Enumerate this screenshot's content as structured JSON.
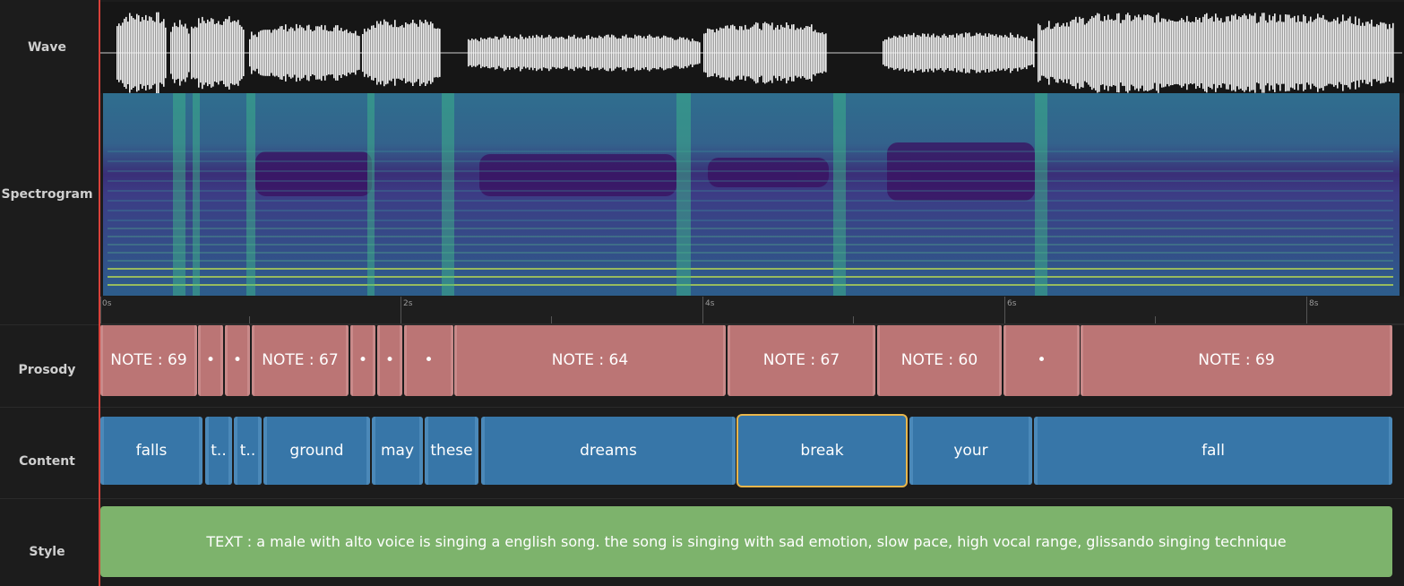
{
  "labels": {
    "wave": "Wave",
    "spectrogram": "Spectrogram",
    "prosody": "Prosody",
    "content": "Content",
    "style": "Style"
  },
  "ruler": {
    "ticks": [
      "0s",
      "2s",
      "4s",
      "6s",
      "8s"
    ]
  },
  "prosody": {
    "segments": [
      {
        "label": "NOTE : 69"
      },
      {
        "label": "•"
      },
      {
        "label": "•"
      },
      {
        "label": "NOTE : 67"
      },
      {
        "label": "•"
      },
      {
        "label": "•"
      },
      {
        "label": "•"
      },
      {
        "label": "NOTE : 64"
      },
      {
        "label": "NOTE : 67"
      },
      {
        "label": "NOTE : 60"
      },
      {
        "label": "•"
      },
      {
        "label": "NOTE : 69"
      }
    ]
  },
  "content": {
    "segments": [
      {
        "label": "falls"
      },
      {
        "label": "t.."
      },
      {
        "label": "t.."
      },
      {
        "label": "ground"
      },
      {
        "label": "may"
      },
      {
        "label": "these"
      },
      {
        "label": "dreams"
      },
      {
        "label": "break",
        "selected": true
      },
      {
        "label": "your"
      },
      {
        "label": "fall"
      }
    ]
  },
  "style": {
    "text": "TEXT : a male with alto voice is singing a english song. the song is singing with sad emotion, slow pace, high vocal range, glissando singing technique"
  },
  "colors": {
    "prosody": "#bb7575",
    "content": "#3776a8",
    "style": "#7db36c",
    "selected_outline": "#e8b64c",
    "playhead": "#d9413a"
  }
}
